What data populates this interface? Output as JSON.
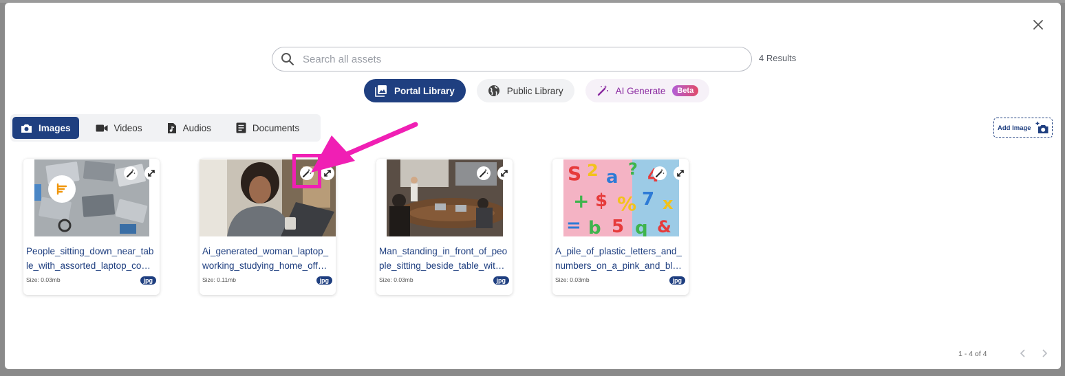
{
  "search": {
    "placeholder": "Search all assets",
    "results": "4 Results"
  },
  "library_tabs": [
    {
      "label": "Portal Library",
      "icon": "image-gallery-icon"
    },
    {
      "label": "Public Library",
      "icon": "globe-icon"
    },
    {
      "label": "AI Generate",
      "icon": "magic-wand-icon",
      "badge": "Beta"
    }
  ],
  "type_tabs": [
    {
      "label": "Images",
      "icon": "camera-icon"
    },
    {
      "label": "Videos",
      "icon": "video-camera-icon"
    },
    {
      "label": "Audios",
      "icon": "music-file-icon"
    },
    {
      "label": "Documents",
      "icon": "document-icon"
    }
  ],
  "add_image_label": "Add Image",
  "cards": [
    {
      "title_line1": "People_sitting_down_near_tab",
      "title_line2": "le_with_assorted_laptop_co…",
      "size": "Size: 0.03mb",
      "ext": "jpg"
    },
    {
      "title_line1": "Ai_generated_woman_laptop_",
      "title_line2": "working_studying_home_off…",
      "size": "Size: 0.11mb",
      "ext": "jpg"
    },
    {
      "title_line1": "Man_standing_in_front_of_peo",
      "title_line2": "ple_sitting_beside_table_wit…",
      "size": "Size: 0.03mb",
      "ext": "jpg"
    },
    {
      "title_line1": "A_pile_of_plastic_letters_and_",
      "title_line2": "numbers_on_a_pink_and_bl…",
      "size": "Size: 0.03mb",
      "ext": "jpg"
    }
  ],
  "pagination": {
    "text": "1 - 4 of 4"
  },
  "colors": {
    "primary": "#1f3f80",
    "annotation": "#f01fb4",
    "ai_purple": "#8a2aa0"
  }
}
